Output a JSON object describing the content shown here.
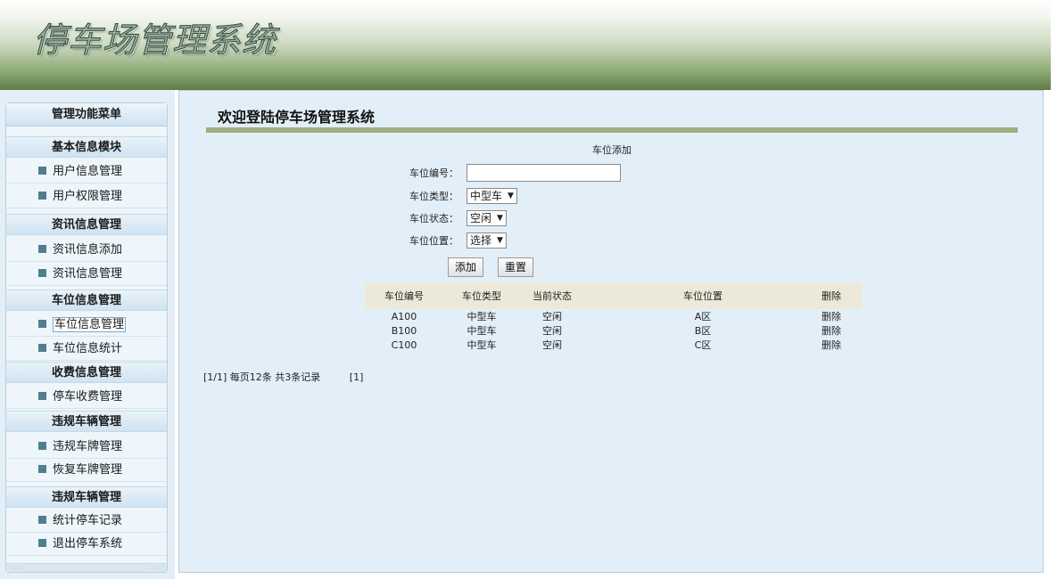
{
  "header": {
    "logo": "停车场管理系统"
  },
  "sidebar": {
    "title": "管理功能菜单",
    "sections": [
      {
        "heading": "基本信息模块",
        "items": [
          "用户信息管理",
          "用户权限管理"
        ]
      },
      {
        "heading": "资讯信息管理",
        "items": [
          "资讯信息添加",
          "资讯信息管理"
        ]
      },
      {
        "heading": "车位信息管理",
        "items": [
          "车位信息管理",
          "车位信息统计"
        ]
      },
      {
        "heading": "收费信息管理",
        "items": [
          "停车收费管理"
        ]
      },
      {
        "heading": "违规车辆管理",
        "items": [
          "违规车牌管理",
          "恢复车牌管理"
        ]
      },
      {
        "heading": "违规车辆管理",
        "items": [
          "统计停车记录",
          "退出停车系统"
        ]
      }
    ],
    "active_item": "车位信息管理"
  },
  "main": {
    "welcome": "欢迎登陆停车场管理系统",
    "form": {
      "title": "车位添加",
      "fields": [
        {
          "label": "车位编号：",
          "value": ""
        },
        {
          "label": "车位类型：",
          "value": "中型车"
        },
        {
          "label": "车位状态：",
          "value": "空闲"
        },
        {
          "label": "车位位置：",
          "value": "选择"
        }
      ],
      "add_button": "添加",
      "reset_button": "重置"
    },
    "table": {
      "headers": [
        "车位编号",
        "车位类型",
        "当前状态",
        "车位位置",
        "删除"
      ],
      "rows": [
        [
          "A100",
          "中型车",
          "空闲",
          "A区",
          "删除"
        ],
        [
          "B100",
          "中型车",
          "空闲",
          "B区",
          "删除"
        ],
        [
          "C100",
          "中型车",
          "空闲",
          "C区",
          "删除"
        ]
      ]
    },
    "pager": {
      "summary": "[1/1] 每页12条 共3条记录",
      "pages": "[1]"
    }
  }
}
